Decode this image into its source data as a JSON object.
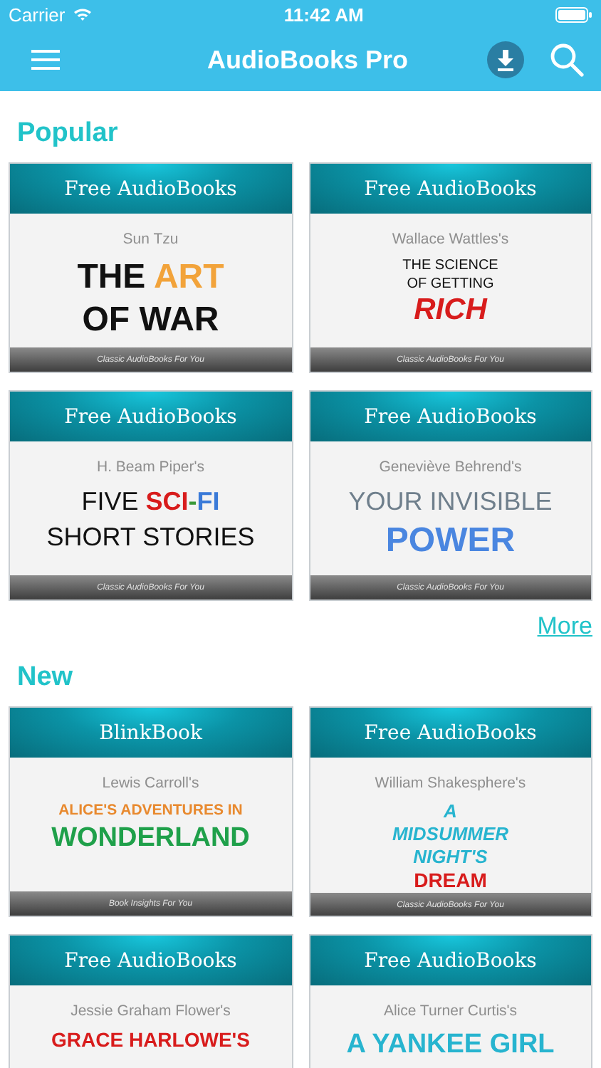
{
  "status_bar": {
    "carrier": "Carrier",
    "time": "11:42 AM"
  },
  "nav_bar": {
    "title": "AudioBooks Pro"
  },
  "sections": [
    {
      "title": "Popular",
      "more": "More",
      "books": [
        {
          "publisher": "Free AudioBooks",
          "author": "Sun Tzu",
          "tagline": "Classic AudioBooks For You",
          "lines": [
            {
              "kind": "huge",
              "parts": [
                {
                  "text": "THE ",
                  "color": "#111111"
                },
                {
                  "text": "ART",
                  "color": "#f2a33a"
                }
              ]
            },
            {
              "kind": "huge",
              "parts": [
                {
                  "text": "OF WAR",
                  "color": "#111111"
                }
              ]
            }
          ]
        },
        {
          "publisher": "Free AudioBooks",
          "author": "Wallace Wattles's",
          "tagline": "Classic AudioBooks For You",
          "lines": [
            {
              "kind": "small",
              "parts": [
                {
                  "text": "THE SCIENCE",
                  "color": "#111111"
                }
              ]
            },
            {
              "kind": "small",
              "parts": [
                {
                  "text": "OF GETTING",
                  "color": "#111111"
                }
              ]
            },
            {
              "kind": "big-italic",
              "parts": [
                {
                  "text": "RICH",
                  "color": "#d81c1c"
                }
              ]
            }
          ]
        },
        {
          "publisher": "Free AudioBooks",
          "author": "H. Beam Piper's",
          "tagline": "Classic AudioBooks For You",
          "lines": [
            {
              "kind": "light",
              "parts": [
                {
                  "text": "FIVE ",
                  "color": "#111111"
                },
                {
                  "text": "**SCI**",
                  "color": "#d81c1c"
                },
                {
                  "text": "**-**",
                  "color": "#3a9a3a"
                },
                {
                  "text": "**FI**",
                  "color": "#3a7ad8"
                }
              ]
            },
            {
              "kind": "light",
              "parts": [
                {
                  "text": "SHORT STORIES",
                  "color": "#111111"
                }
              ]
            }
          ]
        },
        {
          "publisher": "Free AudioBooks",
          "author": "Geneviève Behrend's",
          "tagline": "Classic AudioBooks For You",
          "lines": [
            {
              "kind": "light",
              "parts": [
                {
                  "text": "YOUR INVISIBLE",
                  "color": "#6f7f8c"
                }
              ]
            },
            {
              "kind": "huge",
              "parts": [
                {
                  "text": "POWER",
                  "color": "#4a86e0"
                }
              ]
            }
          ]
        }
      ]
    },
    {
      "title": "New",
      "books": [
        {
          "publisher": "BlinkBook",
          "author": "Lewis Carroll's",
          "tagline": "Book Insights For You",
          "lines": [
            {
              "kind": "small-bold",
              "parts": [
                {
                  "text": "ALICE'S ADVENTURES IN",
                  "color": "#e8892e"
                }
              ]
            },
            {
              "kind": "big",
              "parts": [
                {
                  "text": "WONDERLAND",
                  "color": "#1fa04a"
                }
              ]
            }
          ]
        },
        {
          "publisher": "Free AudioBooks",
          "author": "William Shakesphere's",
          "tagline": "Classic AudioBooks For You",
          "lines": [
            {
              "kind": "mid-italic",
              "parts": [
                {
                  "text": "A",
                  "color": "#27b4cf"
                }
              ]
            },
            {
              "kind": "mid-italic",
              "parts": [
                {
                  "text": "MIDSUMMER",
                  "color": "#27b4cf"
                }
              ]
            },
            {
              "kind": "mid-italic",
              "parts": [
                {
                  "text": "NIGHT'S",
                  "color": "#27b4cf"
                }
              ]
            },
            {
              "kind": "mid",
              "parts": [
                {
                  "text": "DREAM",
                  "color": "#d81c1c"
                }
              ]
            }
          ]
        },
        {
          "publisher": "Free AudioBooks",
          "author": "Jessie Graham Flower's",
          "lines": [
            {
              "kind": "mid",
              "parts": [
                {
                  "text": "GRACE HARLOWE'S",
                  "color": "#d81c1c"
                }
              ]
            }
          ]
        },
        {
          "publisher": "Free AudioBooks",
          "author": "Alice Turner Curtis's",
          "lines": [
            {
              "kind": "big",
              "parts": [
                {
                  "text": "A YANKEE GIRL",
                  "color": "#27b4cf"
                }
              ]
            }
          ]
        }
      ]
    }
  ]
}
